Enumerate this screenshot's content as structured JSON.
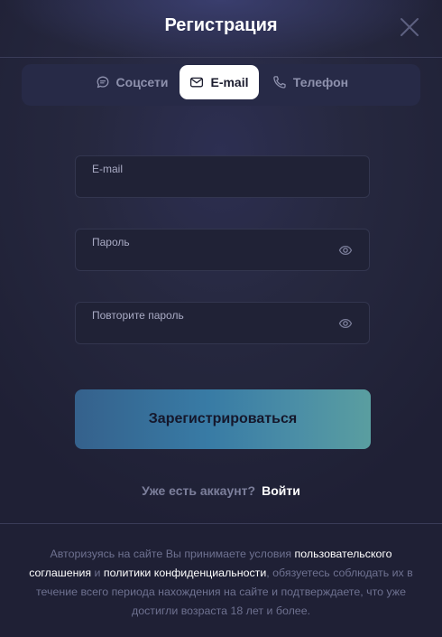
{
  "header": {
    "title": "Регистрация"
  },
  "tabs": [
    {
      "label": "Соцсети",
      "icon": "chat-bubble-icon"
    },
    {
      "label": "E-mail",
      "icon": "envelope-icon"
    },
    {
      "label": "Телефон",
      "icon": "phone-icon"
    }
  ],
  "active_tab": "E-mail",
  "form": {
    "email_label": "E-mail",
    "email_value": "",
    "password_label": "Пароль",
    "password_value": "",
    "repeat_label": "Повторите пароль",
    "repeat_value": "",
    "submit_label": "Зарегистрироваться"
  },
  "login": {
    "question": "Уже есть аккаунт?",
    "link": "Войти"
  },
  "terms": {
    "part1": "Авторизуясь на сайте Вы принимаете условия ",
    "link_agreement": "пользовательского соглашения",
    "part2": " и ",
    "link_privacy": "политики конфиденциальности",
    "part3": ", обязуетесь соблюдать их в течение всего периода нахождения на сайте и подтверждаете, что уже достигли возраста 18 лет и более."
  },
  "colors": {
    "background": "#1f2035",
    "accent_start": "#35618c",
    "accent_end": "#5a9ea0",
    "muted_text": "#6e7190"
  }
}
